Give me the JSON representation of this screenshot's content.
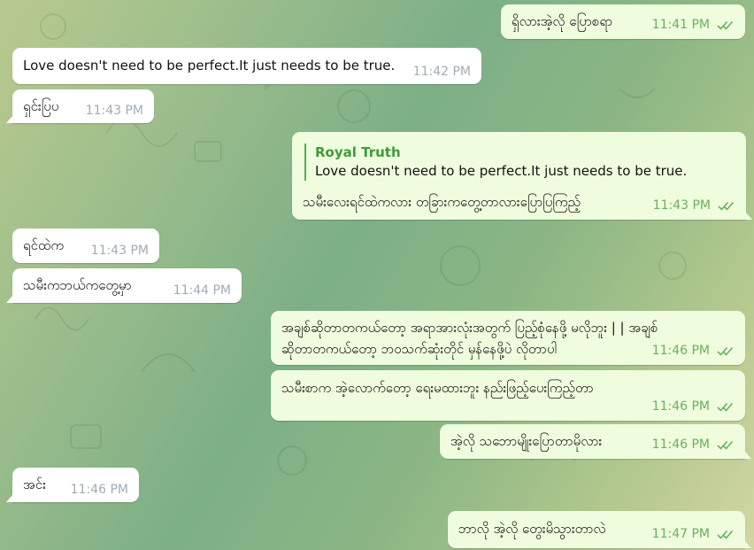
{
  "colors": {
    "incoming_bubble": "#ffffff",
    "outgoing_bubble": "#effdde",
    "time_incoming": "#a0acb6",
    "time_outgoing": "#6aaf5f",
    "reply_accent": "#4fae4e"
  },
  "icons": {
    "read_receipt": "double-check-icon"
  },
  "messages": [
    {
      "direction": "outgoing",
      "text": "ရှိလားအဲ့လို ပြောစရာ",
      "time": "11:41 PM",
      "status": "read"
    },
    {
      "direction": "incoming",
      "text": "Love doesn't need to be perfect.It just needs to be true.",
      "time": "11:42 PM"
    },
    {
      "direction": "incoming",
      "text": "ရှင်းပြပ",
      "time": "11:43 PM"
    },
    {
      "direction": "outgoing",
      "reply_name": "Royal Truth",
      "reply_text": "Love doesn't need to be perfect.It just needs to be true.",
      "text": "သမီးလေးရင်ထဲကလား တခြားကတွေ့တာလားပြောပြကြည့်",
      "time": "11:43 PM",
      "status": "read"
    },
    {
      "direction": "incoming",
      "text": "ရင်ထဲက",
      "time": "11:43 PM"
    },
    {
      "direction": "incoming",
      "text": "သမီးကဘယ်ကတွေ့မှာ",
      "time": "11:44 PM"
    },
    {
      "direction": "outgoing",
      "text_line1": "အချစ်ဆိုတာတကယ်တော့ အရာအားလုံးအတွက် ပြည့်စုံနေဖို့ မလိုဘူး | | အချစ်",
      "text_line2": "ဆိုတာတကယ်တော့ ဘဝသက်ဆုံးတိုင် မှန်နေဖို့ပဲ လိုတာပါ",
      "time": "11:46 PM",
      "status": "read"
    },
    {
      "direction": "outgoing",
      "text": "သမီးစာက အဲ့လောက်တော့ ရေးမထားဘူး နည်းဖြည့်ပေးကြည့်တာ",
      "time": "11:46 PM",
      "status": "read"
    },
    {
      "direction": "outgoing",
      "text": "အဲ့လို သဘောမျိုးပြောတာမိုလား",
      "time": "11:46 PM",
      "status": "read"
    },
    {
      "direction": "incoming",
      "text": "အင်း",
      "time": "11:46 PM"
    },
    {
      "direction": "outgoing",
      "text": "ဘာလို အဲ့လို တွေးမိသွားတာလဲ",
      "time": "11:47 PM",
      "status": "read"
    }
  ]
}
